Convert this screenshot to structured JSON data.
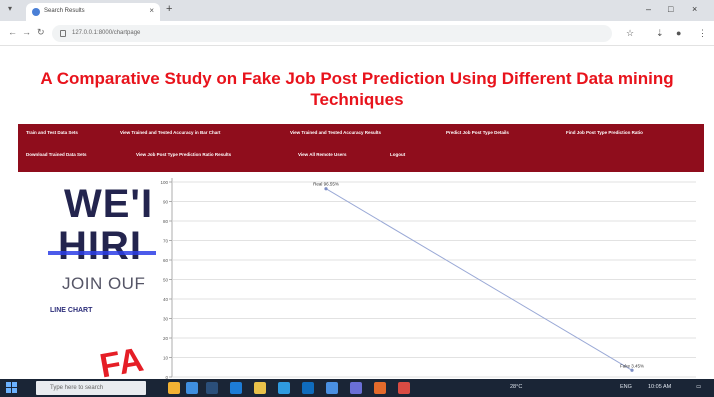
{
  "browser": {
    "tab_title": "Search Results",
    "tab_close": "×",
    "new_tab": "+",
    "url": "127.0.0.1:8000/chartpage",
    "window_controls": [
      "–",
      "□",
      "×"
    ],
    "nav_icons": [
      "back-icon",
      "forward-icon",
      "reload-icon"
    ]
  },
  "page": {
    "title": "A Comparative Study on Fake Job Post Prediction Using Different Data mining Techniques"
  },
  "nav": {
    "row1": [
      "Train and Test Data Sets",
      "View Trained and Tested Accuracy in Bar Chart",
      "View Trained and Tested Accuracy Results",
      "Predict Job Post Type Details",
      "Find Job Post Type Prediction Ratio"
    ],
    "row2": [
      "Download Trained Data Sets",
      "View Job Post Type Prediction Ratio Results",
      "View All Remote Users",
      "Logout"
    ]
  },
  "promo": {
    "word1": "WE'I",
    "word2": "HIRI",
    "word3": "JOIN OUF",
    "side_label": "LINE CHART",
    "word4": "FA"
  },
  "chart_data": {
    "type": "line",
    "ylim": [
      0,
      100
    ],
    "yticks": [
      "0",
      "10",
      "20",
      "30",
      "40",
      "50",
      "60",
      "70",
      "80",
      "90",
      "100"
    ],
    "series": [
      {
        "points": [
          {
            "label": "Real 96.55%",
            "value": 96.55
          },
          {
            "label": "Fake 3.45%",
            "value": 3.45
          }
        ]
      }
    ],
    "line_color": "#9aa9d6",
    "grid": true
  },
  "taskbar": {
    "search_placeholder": "Type here to search",
    "weather": "28°C",
    "lang": "ENG",
    "time": "10:05 AM"
  }
}
